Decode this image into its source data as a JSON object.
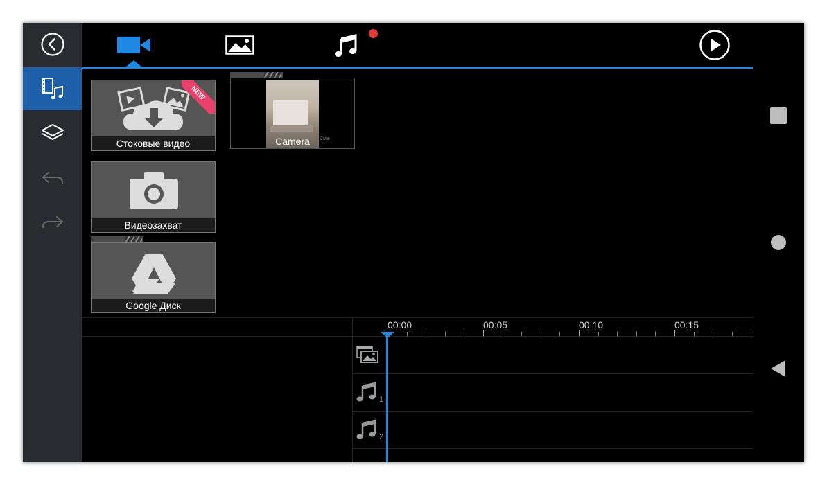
{
  "tabs": [
    {
      "name": "video",
      "icon": "video-camera-icon",
      "active": true
    },
    {
      "name": "image",
      "icon": "image-icon",
      "active": false
    },
    {
      "name": "music",
      "icon": "music-note-icon",
      "active": false,
      "has_notification_dot": true
    }
  ],
  "media_tiles": {
    "stock": {
      "label": "Стоковые видео",
      "badge": "NEW"
    },
    "camera": {
      "label": "Camera",
      "thumb_overlay": "Cute"
    },
    "capture": {
      "label": "Видеозахват"
    },
    "gdrive": {
      "label": "Google Диск"
    }
  },
  "timeline": {
    "time_labels": [
      "00:00",
      "00:05",
      "00:10",
      "00:15"
    ],
    "tracks": [
      {
        "type": "video-image",
        "number": ""
      },
      {
        "type": "audio",
        "number": "1"
      },
      {
        "type": "audio",
        "number": "2"
      }
    ]
  },
  "colors": {
    "accent": "#1e88e5",
    "sidebar_active": "#1d5fa8",
    "notification": "#e53935",
    "new_badge": "#e8416a"
  }
}
